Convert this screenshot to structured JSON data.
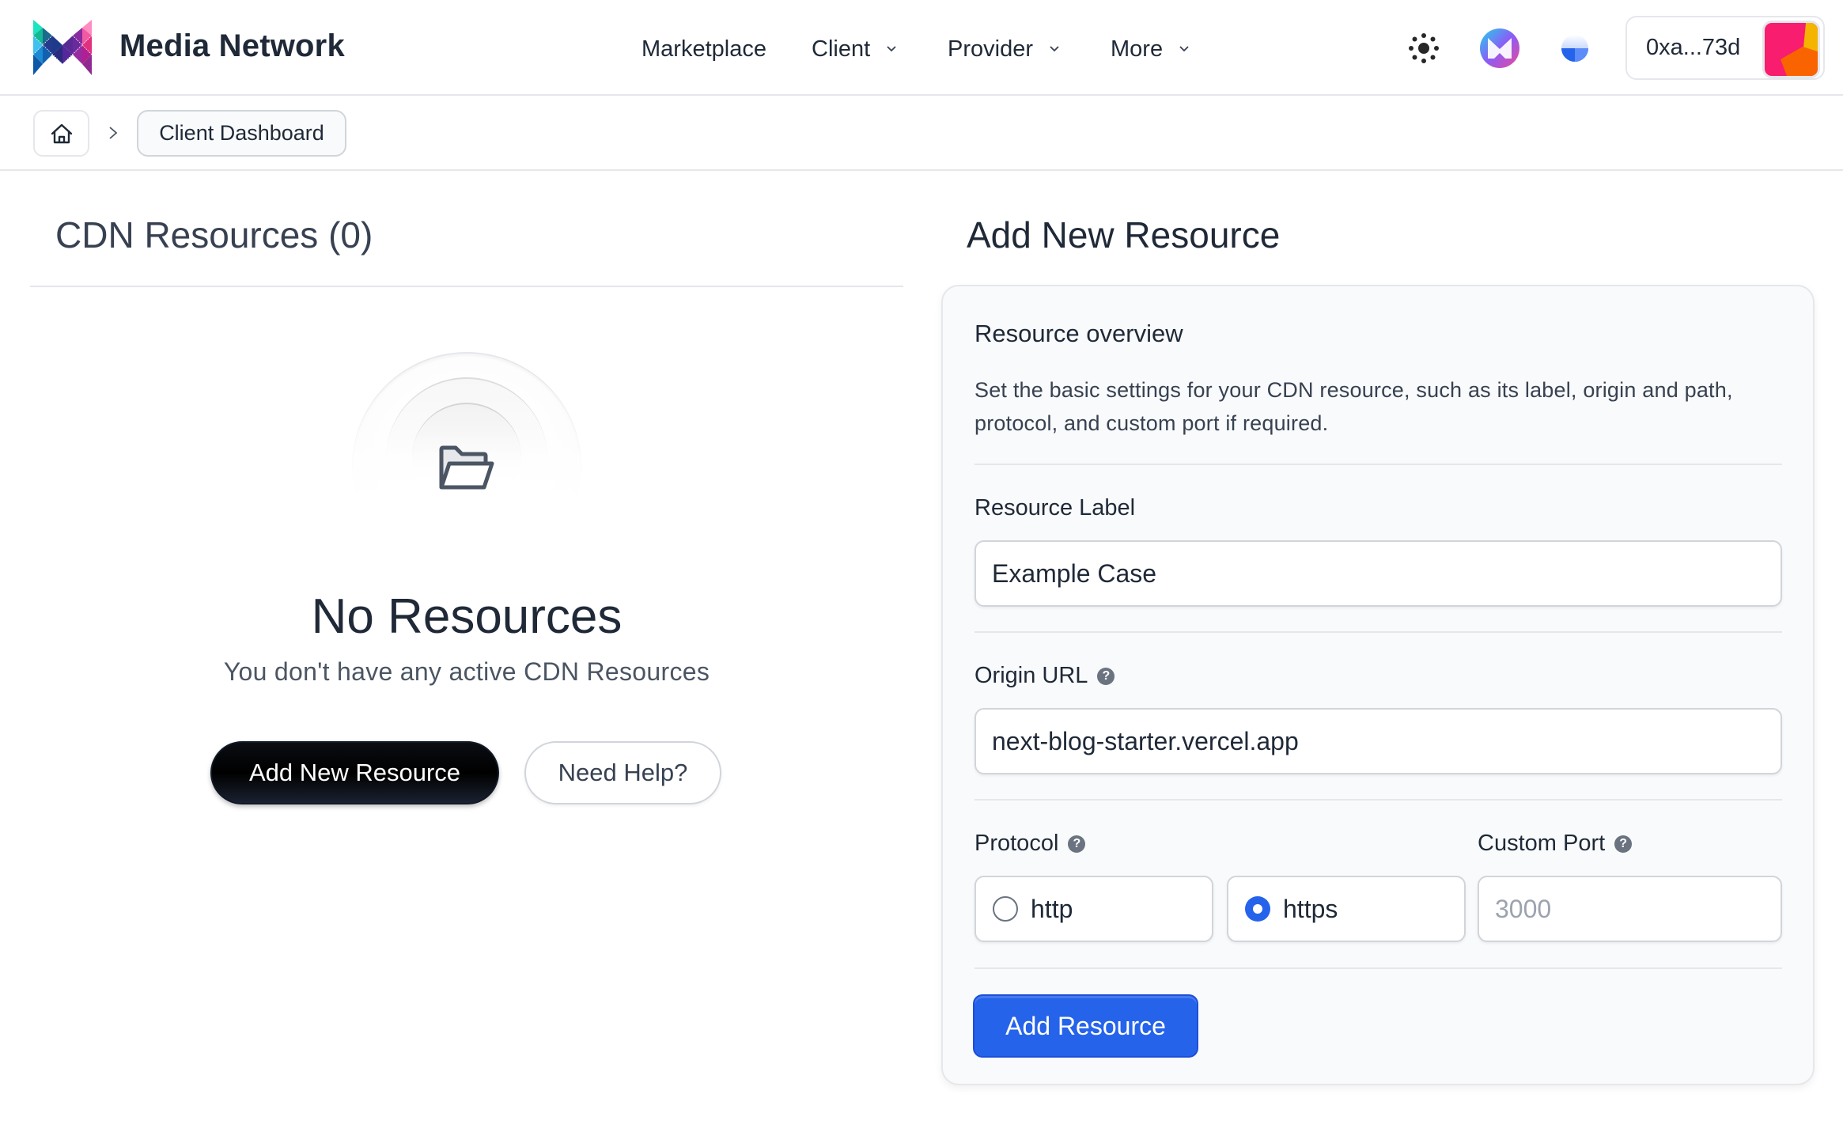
{
  "header": {
    "brand": "Media Network",
    "nav": [
      {
        "label": "Marketplace",
        "has_dropdown": false
      },
      {
        "label": "Client",
        "has_dropdown": true
      },
      {
        "label": "Provider",
        "has_dropdown": true
      },
      {
        "label": "More",
        "has_dropdown": true
      }
    ],
    "icons": [
      "theme-toggle-icon",
      "media-network-token-icon",
      "network-status-icon"
    ],
    "wallet": {
      "address": "0xa...73d"
    }
  },
  "breadcrumb": {
    "home_icon": "home-icon",
    "items": [
      {
        "label": "Client Dashboard"
      }
    ]
  },
  "left": {
    "title": "CDN Resources (0)",
    "empty": {
      "icon": "folder-open-icon",
      "title": "No Resources",
      "subtitle": "You don't have any active CDN Resources",
      "primary_button": "Add New Resource",
      "secondary_button": "Need Help?"
    }
  },
  "right": {
    "title": "Add New Resource",
    "overview": {
      "title": "Resource overview",
      "description": "Set the basic settings for your CDN resource, such as its label, origin and path, protocol, and custom port if required."
    },
    "fields": {
      "label": {
        "label": "Resource Label",
        "value": "Example Case"
      },
      "origin": {
        "label": "Origin URL",
        "value": "next-blog-starter.vercel.app"
      },
      "protocol": {
        "label": "Protocol",
        "options": [
          {
            "label": "http",
            "selected": false
          },
          {
            "label": "https",
            "selected": true
          }
        ]
      },
      "port": {
        "label": "Custom Port",
        "value": "",
        "placeholder": "3000"
      }
    },
    "submit": "Add Resource"
  },
  "colors": {
    "accent": "#2563eb",
    "text": "#1f2937",
    "border": "#e5e7eb",
    "card_bg": "#f9fafb"
  }
}
